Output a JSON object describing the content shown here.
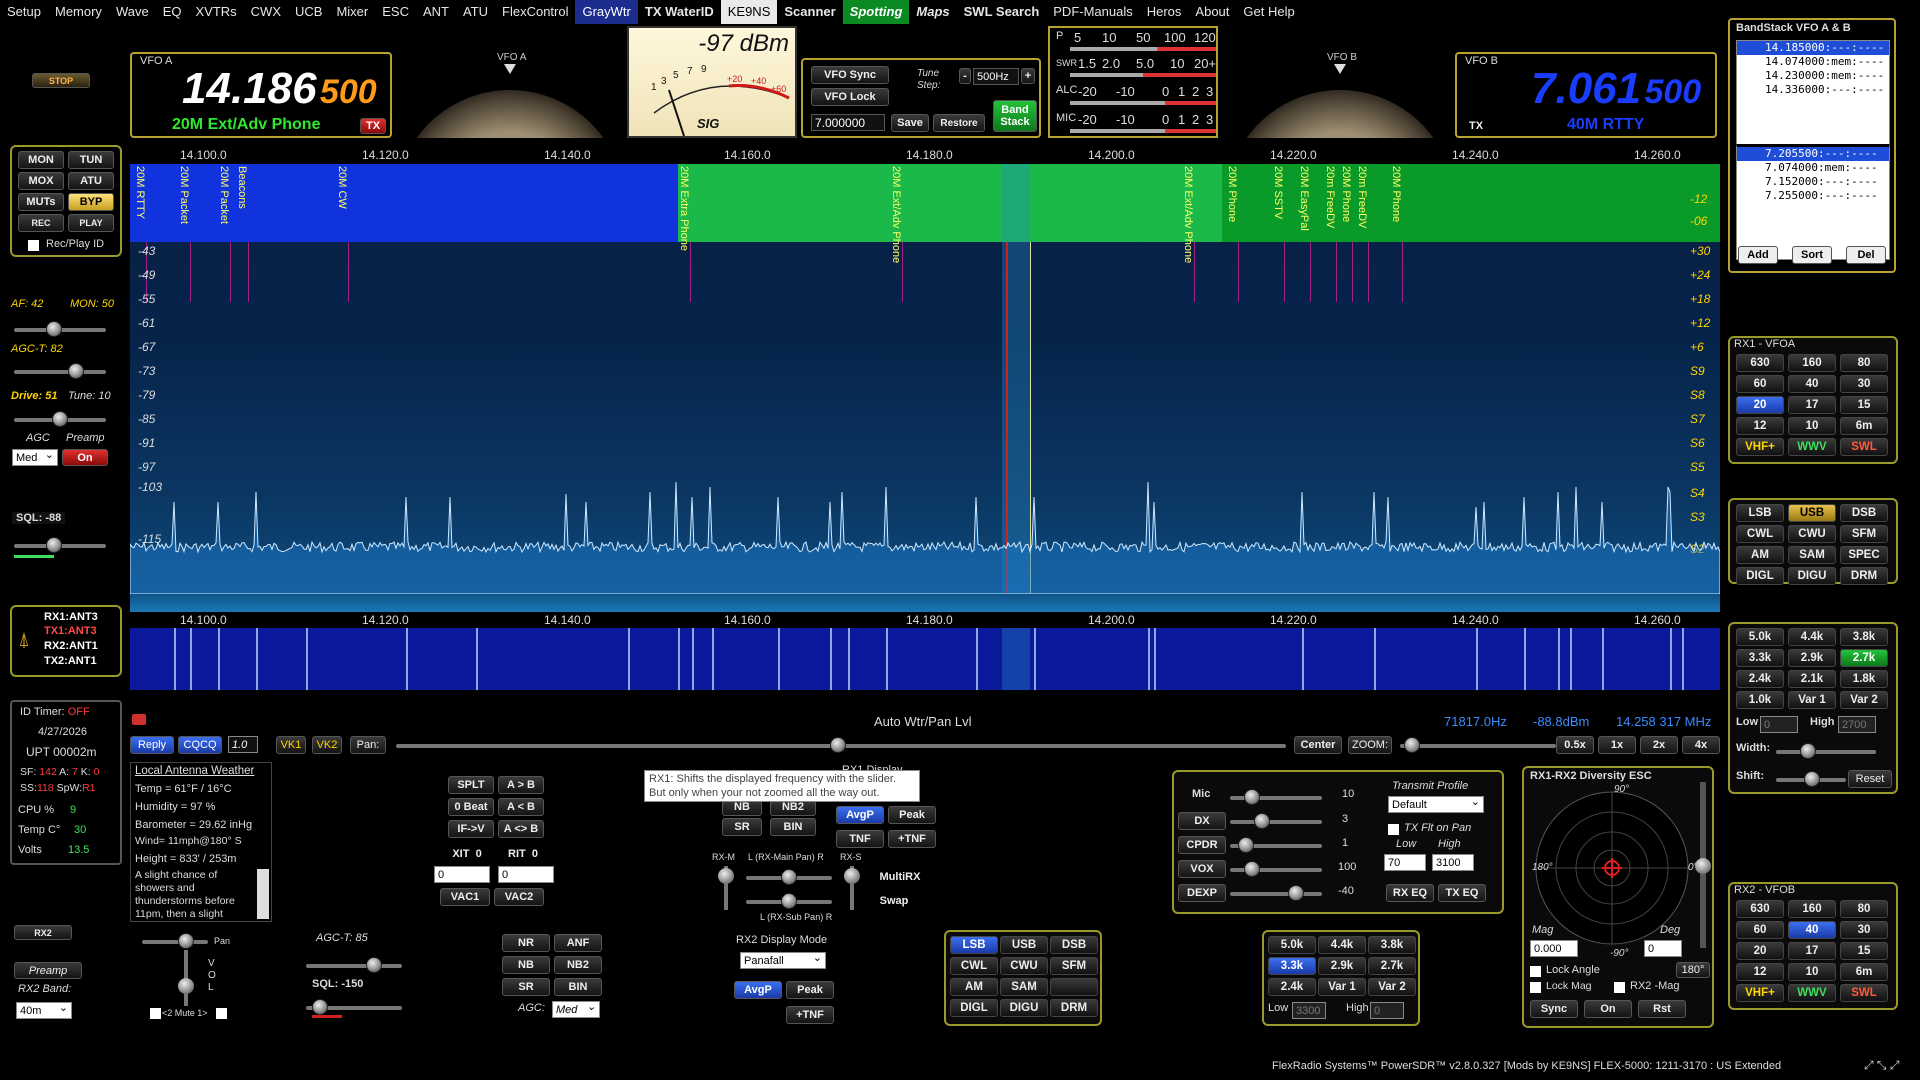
{
  "menu": [
    "Setup",
    "Memory",
    "Wave",
    "EQ",
    "XVTRs",
    "CWX",
    "UCB",
    "Mixer",
    "ESC",
    "ANT",
    "ATU",
    "FlexControl",
    "GrayWtr",
    "TX WaterID",
    "KE9NS",
    "Scanner",
    "Spotting",
    "Maps",
    "SWL Search",
    "PDF-Manuals",
    "Heros",
    "About",
    "Get Help"
  ],
  "stop_label": "STOP",
  "vfoa": {
    "title": "VFO A",
    "freq_main": "14.186",
    "freq_sub": "500",
    "band_text": "20M Ext/Adv Phone",
    "tx_badge": "TX"
  },
  "vfob": {
    "title": "VFO B",
    "freq_main": "7.061",
    "freq_sub": "500",
    "band_text": "40M RTTY",
    "tx_badge": "TX"
  },
  "dial_a_label": "VFO A",
  "dial_b_label": "VFO B",
  "meter": {
    "reading": "-97 dBm",
    "sig_label": "SIG",
    "scale": [
      "1",
      "3",
      "5",
      "7",
      "9",
      "+20",
      "+40",
      "+60"
    ]
  },
  "vfo_controls": {
    "sync": "VFO Sync",
    "lock": "VFO Lock",
    "tune_step_label": "Tune Step:",
    "tune_step_value": "500Hz",
    "minus": "-",
    "plus": "+",
    "freq_value": "7.000000",
    "save": "Save",
    "restore": "Restore",
    "band_stack": "Band Stack"
  },
  "tx_meters": {
    "p": {
      "label": "P",
      "ticks": [
        "5",
        "10",
        "50",
        "100",
        "120"
      ]
    },
    "swr": {
      "label": "SWR",
      "ticks": [
        "1.5",
        "2.0",
        "5.0",
        "10",
        "20+"
      ]
    },
    "alc": {
      "label": "ALC",
      "ticks": [
        "-20",
        "-10",
        "0",
        "1",
        "2",
        "3"
      ]
    },
    "mic": {
      "label": "MIC",
      "ticks": [
        "-20",
        "-10",
        "0",
        "1",
        "2",
        "3"
      ]
    }
  },
  "left_buttons": {
    "mon": "MON",
    "tun": "TUN",
    "mox": "MOX",
    "atu": "ATU",
    "muts": "MUTs",
    "byp": "BYP",
    "rec": "REC",
    "play": "PLAY",
    "recplay_id": "Rec/Play ID"
  },
  "left_levels": {
    "af": "AF: 42",
    "mon": "MON: 50",
    "agct": "AGC-T: 82",
    "drive": "Drive: 51",
    "tune": "Tune: 10",
    "agc": "AGC",
    "preamp": "Preamp",
    "agc_value": "Med",
    "preamp_value": "On",
    "sql": "SQL: -88"
  },
  "antenna": {
    "rx1": "RX1:ANT3",
    "tx1": "TX1:ANT3",
    "rx2": "RX2:ANT1",
    "tx2": "TX2:ANT1"
  },
  "info": {
    "id_timer": "ID Timer:",
    "id_timer_val": "OFF",
    "date": "4/27/2026",
    "upt": "UPT  00002m",
    "sf": "SF: ",
    "sf_val": "142",
    "a": " A: ",
    "a_val": "7",
    "k": " K: ",
    "k_val": "0",
    "ss": "SS:",
    "ss_val": "118",
    "spw": " SpW:",
    "spw_val": "R1",
    "cpu": "CPU %",
    "cpu_val": "9",
    "temp": "Temp C°",
    "temp_val": "30",
    "volts": "Volts",
    "volts_val": "13.5"
  },
  "rx2_left": {
    "rx2": "RX2",
    "preamp": "Preamp",
    "band_label": "RX2 Band:",
    "band_value": "40m"
  },
  "pan_freqs": [
    "14.100.0",
    "14.120.0",
    "14.140.0",
    "14.160.0",
    "14.180.0",
    "14.200.0",
    "14.220.0",
    "14.240.0",
    "14.260.0"
  ],
  "pan_db_left": [
    "-43",
    "-49",
    "-55",
    "-61",
    "-67",
    "-73",
    "-79",
    "-85",
    "-91",
    "-97",
    "-103",
    "-115"
  ],
  "pan_db_right": [
    "-12",
    "-06",
    "+30",
    "+24",
    "+18",
    "+12",
    "+6",
    "S9",
    "S8",
    "S7",
    "S6",
    "S5",
    "S4",
    "S3",
    "S2"
  ],
  "bands": [
    "20M RTTY",
    "20M Packet",
    "20M Packet",
    "Beacons",
    "20M CW",
    "20M Extra Phone",
    "20M Ext/Adv Phone",
    "20M Ext/Adv Phone",
    "20M Phone",
    "20M SSTV",
    "20M EasyPal",
    "20m FreeDV",
    "20M Phone",
    "20m FreeDV",
    "20M Phone"
  ],
  "wf_freqs": [
    "14.100.0",
    "14.120.0",
    "14.140.0",
    "14.160.0",
    "14.180.0",
    "14.200.0",
    "14.220.0",
    "14.240.0",
    "14.260.0"
  ],
  "lower_bar": {
    "auto_label": "Auto Wtr/Pan Lvl",
    "hz": "71817.0Hz",
    "dbm": "-88.8dBm",
    "mhz": "14.258 317 MHz",
    "reply": "Reply",
    "cqcq": "CQCQ",
    "speed": "1.0",
    "vk1": "VK1",
    "vk2": "VK2",
    "pan": "Pan:",
    "center": "Center",
    "zoom": "ZOOM:",
    "z05": "0.5x",
    "z1": "1x",
    "z2": "2x",
    "z4": "4x"
  },
  "weather": {
    "title": "Local Antenna Weather",
    "temp": "Temp = 61°F / 16°C",
    "hum": "Humidity = 97 %",
    "baro": "Barometer = 29.62 inHg",
    "wind": "Wind= 11mph@180° S",
    "height": "Height = 833' / 253m",
    "forecast": "A slight chance of showers and thunderstorms before 11pm, then a slight"
  },
  "rx1_mid": {
    "splt": "SPLT",
    "atob": "A > B",
    "zbeat": "0 Beat",
    "btoa": "A < B",
    "ifv": "IF->V",
    "aswap": "A <> B",
    "xit": "XIT",
    "xit_v": "0",
    "rit": "RIT",
    "rit_v": "0",
    "xit_in": "0",
    "rit_in": "0",
    "vac1": "VAC1",
    "vac2": "VAC2"
  },
  "tooltip": "RX1: Shifts the displayed frequency with the slider. But only when your not zoomed all the way out.",
  "rx1display": "RX1 Display",
  "dsp1": {
    "nb": "NB",
    "nb2": "NB2",
    "sr": "SR",
    "bin": "BIN",
    "avgp": "AvgP",
    "peak": "Peak",
    "tnf": "TNF",
    "ptnf": "+TNF",
    "multirx": "MultiRX",
    "swap": "Swap",
    "rxm": "RX-M",
    "rxs": "RX-S",
    "lmain": "L (RX-Main Pan) R",
    "lsub": "L (RX-Sub Pan) R"
  },
  "rx2_lower": {
    "pan": "Pan",
    "vol": "V\nO\nL",
    "mute": "<2 Mute 1>",
    "agct": "AGC-T:  85",
    "sql": "SQL:  -150",
    "nr": "NR",
    "anf": "ANF",
    "nb": "NB",
    "nb2": "NB2",
    "sr": "SR",
    "bin": "BIN",
    "agc": "AGC:",
    "agc_value": "Med"
  },
  "rx2_display": {
    "label": "RX2 Display Mode",
    "value": "Panafall",
    "avgp": "AvgP",
    "peak": "Peak",
    "tnf": "+TNF"
  },
  "mode_panel2": [
    "LSB",
    "USB",
    "DSB",
    "CWL",
    "CWU",
    "SFM",
    "AM",
    "SAM",
    "",
    "DIGL",
    "DIGU",
    "DRM"
  ],
  "tx_panel": {
    "mic": "Mic",
    "mic_v": "10",
    "dx": "DX",
    "dx_v": "3",
    "cpdr": "CPDR",
    "cpdr_v": "1",
    "vox": "VOX",
    "vox_v": "100",
    "dexp": "DEXP",
    "dexp_v": "-40",
    "profile_label": "Transmit Profile",
    "profile_value": "Default",
    "flt_label": "TX Flt on Pan",
    "low": "Low",
    "high": "High",
    "low_v": "70",
    "high_v": "3100",
    "rxeq": "RX EQ",
    "txeq": "TX EQ"
  },
  "filt2": [
    "5.0k",
    "4.4k",
    "3.8k",
    "3.3k",
    "2.9k",
    "2.7k",
    "2.4k",
    "Var 1",
    "Var 2"
  ],
  "filt2_low": "Low",
  "filt2_high": "High",
  "filt2_low_v": "3300",
  "filt2_high_v": "0",
  "diversity": {
    "title": "RX1-RX2 Diversity ESC",
    "d90": "90°",
    "d180": "180°",
    "d0": "0°",
    "dm90": "-90°",
    "mag": "Mag",
    "deg": "Deg",
    "mag_v": "0.000",
    "deg_v": "0",
    "angle180": "180°",
    "lock_angle": "Lock Angle",
    "lock_mag": "Lock Mag",
    "rx2mag": "RX2 -Mag",
    "sync": "Sync",
    "on": "On",
    "rst": "Rst"
  },
  "bandstack": {
    "title": "BandStack VFO A & B",
    "a": [
      "14.185000:---:----",
      "14.074000:mem:----",
      "14.230000:mem:----",
      "14.336000:---:----"
    ],
    "b": [
      "7.205500:---:----",
      "7.074000:mem:----",
      "7.152000:---:----",
      "7.255000:---:----"
    ],
    "add": "Add",
    "sort": "Sort",
    "del": "Del"
  },
  "rx1_bands": {
    "title": "RX1 - VFOA",
    "items": [
      "630",
      "160",
      "80",
      "60",
      "40",
      "30",
      "20",
      "17",
      "15",
      "12",
      "10",
      "6m",
      "VHF+",
      "WWV",
      "SWL"
    ]
  },
  "modes": [
    "LSB",
    "USB",
    "DSB",
    "CWL",
    "CWU",
    "SFM",
    "AM",
    "SAM",
    "SPEC",
    "DIGL",
    "DIGU",
    "DRM"
  ],
  "filters": [
    "5.0k",
    "4.4k",
    "3.8k",
    "3.3k",
    "2.9k",
    "2.7k",
    "2.4k",
    "2.1k",
    "1.8k",
    "1.0k",
    "Var 1",
    "Var 2"
  ],
  "filter_extra": {
    "low": "Low",
    "low_v": "0",
    "high": "High",
    "high_v": "2700",
    "width": "Width:",
    "shift": "Shift:",
    "reset": "Reset"
  },
  "rx2_bands": {
    "title": "RX2 - VFOB",
    "items": [
      "630",
      "160",
      "80",
      "60",
      "40",
      "30",
      "20",
      "17",
      "15",
      "12",
      "10",
      "6m",
      "VHF+",
      "WWV",
      "SWL"
    ]
  },
  "status": "FlexRadio Systems™  PowerSDR™ v2.8.0.327  [Mods by KE9NS]  FLEX-5000: 1211-3170 : US Extended"
}
